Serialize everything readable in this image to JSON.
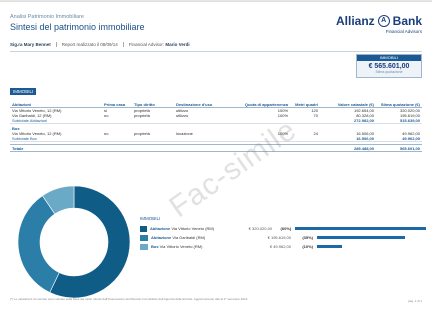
{
  "header": {
    "small_title": "Analisi Patrimonio Immobiliare",
    "title": "Sintesi del patrimonio immobiliare",
    "client": "Sig.ra Mary Bennet",
    "report_label": "Report realizzato il 08/09/14",
    "advisor_label": "Financial Advisor:",
    "advisor_name": "Mario Verdi"
  },
  "logo": {
    "brand": "Allianz",
    "symbol": "A",
    "brand_suffix": "Bank",
    "sub": "Financial Advisors"
  },
  "badge": {
    "label": "IMMOBILI",
    "value": "€ 565.601,00",
    "sub": "Stima quotazione"
  },
  "section_tag": "IMMOBILI",
  "table": {
    "headers": [
      "Abitazioni",
      "Prima casa",
      "Tipo diritto",
      "Destinazione d'uso",
      "Quota di appartenenza",
      "Metri quadri",
      "Valore catastale (€)",
      "Stima quotazione (€)"
    ],
    "groups": [
      {
        "rows": [
          [
            "Via Vittorio Veneto, 12 (RM)",
            "sì",
            "proprietà",
            "utilizzo",
            "100%",
            "120",
            "192.654,00",
            "320.020,00"
          ],
          [
            "Via Garibaldi, 12 (RM)",
            "no",
            "proprietà",
            "utilizzo",
            "100%",
            "70",
            "80.328,00",
            "195.619,00"
          ]
        ],
        "subtotal_label": "Subtotale Abitazioni",
        "subtotal_cat": "272.982,00",
        "subtotal_est": "515.639,00"
      },
      {
        "name": "Box",
        "rows": [
          [
            "Via Vittorio Veneto, 12 (RM)",
            "no",
            "proprietà",
            "locazione",
            "100%",
            "24",
            "16.506,00",
            "49.962,00"
          ]
        ],
        "subtotal_label": "Subtotale Box",
        "subtotal_cat": "16.506,00",
        "subtotal_est": "49.962,00"
      }
    ],
    "total_label": "Totale",
    "total_cat": "289.488,00",
    "total_est": "565.601,00"
  },
  "watermark": "Fac-simile",
  "legend": {
    "tag": "IMMOBILI",
    "items": [
      {
        "type": "Abitazione",
        "name": "Via Vittorio Veneto (RM)",
        "value": "€ 320.020,00",
        "pct": "(60%)",
        "share": 0.6,
        "color": "#0f5d86"
      },
      {
        "type": "Abitazione",
        "name": "Via Garibaldi (RM)",
        "value": "€ 195.619,00",
        "pct": "(35%)",
        "share": 0.35,
        "color": "#2a7ea8"
      },
      {
        "type": "Box",
        "name": "Via Vittorio Veneto (RM)",
        "value": "€ 49.962,00",
        "pct": "(10%)",
        "share": 0.1,
        "color": "#6aaac6"
      }
    ]
  },
  "footnote": "(*) Le valutazioni di mercato sono stimate sulla base dei valori rilevati dall'Osservatorio del Mercato Immobiliare dell'Agenzia delle Entrate. Aggiornamento dati al 2° semestre 2013.",
  "page_number": "pag. 1 di 1"
}
